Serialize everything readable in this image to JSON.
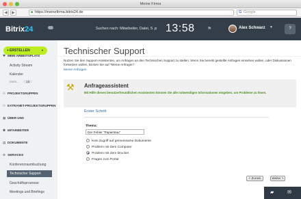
{
  "browser": {
    "window_title": "Meine Firma",
    "url": "https://meinefirma.bitrix24.de",
    "search_placeholder": "Google",
    "back_glyph": "◀",
    "forward_glyph": "▶",
    "lock_glyph": "🔒"
  },
  "header": {
    "logo_main": "Bitrix",
    "logo_num": "24",
    "search_text": "Suchen nach: Mitarbeiter, Datei, S",
    "clock": "13:58",
    "username": "Alex Schwarz",
    "help_label": "?"
  },
  "sidebar": {
    "create_label": "ERSTELLEN",
    "sections": {
      "arbeitsplatz": "MEIN ARBEITSPLATZ",
      "projektgruppen": "PROJEKTGRUPPEN",
      "extranet": "EXTRANET-PROJEKTGRUPPEN",
      "ueber_uns": "ÜBER UNS",
      "mitarbeiter": "MITARBEITER",
      "dokumente": "DOKUMENTE",
      "services": "SERVICES"
    },
    "arbeitsplatz_items": [
      "Activity Stream",
      "Kalender"
    ],
    "more_label": "Mehr...",
    "more_count": "16",
    "services_items": [
      "Konferenzraumbuchung",
      "Technischer Support",
      "Geschäftsprozesse",
      "Meetings und Briefings"
    ]
  },
  "main": {
    "title": "Technischer Support",
    "intro": "Nutzen Sie den Support-Assistenten, um Anfragen an den Technischen Support zu stellen. Wenn Sie bereits gestellte Anfragen einsehen wollen, oder Diskussionen fortsetzen wollen, klicken Sie auf \"Meine Anfragen\".",
    "my_requests_link": "Meine Anfragen",
    "assistant": {
      "title": "Anfrageassistent",
      "description": "Mit Hilfe dieses benutzerfreundlichen Assistenten können Sie alle notwendigen Informationen eingeben, um Probleme zu lösen."
    },
    "step_link": "Erster Schritt",
    "theme_label": "Thema:",
    "theme_value": "Der Fehler \"Papierstau\"",
    "options": [
      "Kein Zugriff auf gemeinsame Dokumente",
      "Problem mit dem Computer",
      "Problem mit dem Drucker",
      "Fragen zum Portal"
    ],
    "selected_option_index": 2,
    "back_button": "< Zurück",
    "next_button": "Weiter >"
  }
}
